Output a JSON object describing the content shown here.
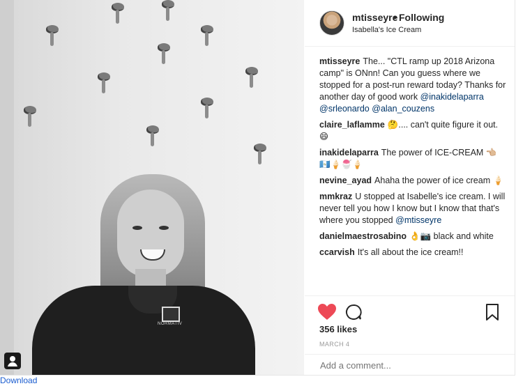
{
  "header": {
    "username": "mtisseyre",
    "separator": "•",
    "follow_label": "Following",
    "location": "Isabella's Ice Cream"
  },
  "caption": {
    "username": "mtisseyre",
    "text": "The... \"CTL ramp up 2018 Arizona camp\" is ONnn! Can you guess where we stopped for a post-run reward today? Thanks for another day of good work",
    "tags": [
      "@inakidelaparra",
      "@srleonardo",
      "@alan_couzens"
    ]
  },
  "comments": [
    {
      "username": "claire_laflamme",
      "text": "🤔.... can't quite figure it out. 😄"
    },
    {
      "username": "inakidelaparra",
      "text": "The power of ICE-CREAM 👈🏼 🇬🇹🍦🍧🍦"
    },
    {
      "username": "nevine_ayad",
      "text": "Ahaha the power of ice cream 🍦"
    },
    {
      "username": "mmkraz",
      "text": "U stopped at Isabelle's ice cream. I will never tell you how I know but I know that that's where you stopped",
      "tag": "@mtisseyre"
    },
    {
      "username": "danielmaestrosabino",
      "text": "👌📷 black and white"
    },
    {
      "username": "ccarvish",
      "text": "It's all about the ice cream!!"
    }
  ],
  "actions": {
    "like_icon": "heart-icon",
    "comment_icon": "comment-icon",
    "save_icon": "bookmark-icon",
    "liked_color": "#ed4956"
  },
  "likes": "356 likes",
  "date": "MARCH 4",
  "add_comment_placeholder": "Add a comment...",
  "download_label": "Download"
}
